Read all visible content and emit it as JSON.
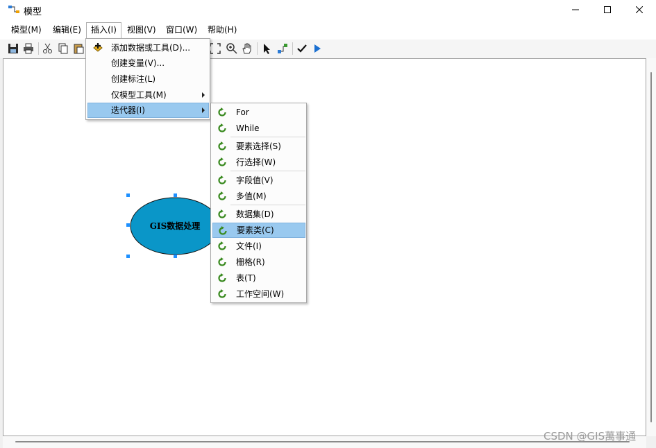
{
  "window": {
    "title": "模型"
  },
  "menubar": [
    {
      "label": "模型(M)"
    },
    {
      "label": "编辑(E)"
    },
    {
      "label": "插入(I)"
    },
    {
      "label": "视图(V)"
    },
    {
      "label": "窗口(W)"
    },
    {
      "label": "帮助(H)"
    }
  ],
  "insert_menu": [
    {
      "label": "添加数据或工具(D)...",
      "icon": "add-data-icon"
    },
    {
      "label": "创建变量(V)..."
    },
    {
      "label": "创建标注(L)"
    },
    {
      "label": "仅模型工具(M)",
      "submenu": true
    },
    {
      "label": "迭代器(I)",
      "submenu": true,
      "highlighted": true
    }
  ],
  "iterator_menu": [
    {
      "label": "For"
    },
    {
      "label": "While"
    },
    {
      "label": "要素选择(S)"
    },
    {
      "label": "行选择(W)"
    },
    {
      "label": "字段值(V)"
    },
    {
      "label": "多值(M)"
    },
    {
      "label": "数据集(D)"
    },
    {
      "label": "要素类(C)",
      "highlighted": true
    },
    {
      "label": "文件(I)"
    },
    {
      "label": "栅格(R)"
    },
    {
      "label": "表(T)"
    },
    {
      "label": "工作空间(W)"
    }
  ],
  "diagram": {
    "node_label": "GIS数据处理",
    "node_color": "#0a96c8"
  },
  "colors": {
    "highlight": "#99c9ef",
    "iterator_icon": "#3a8a20"
  },
  "watermark": "CSDN @GIS萬事通"
}
